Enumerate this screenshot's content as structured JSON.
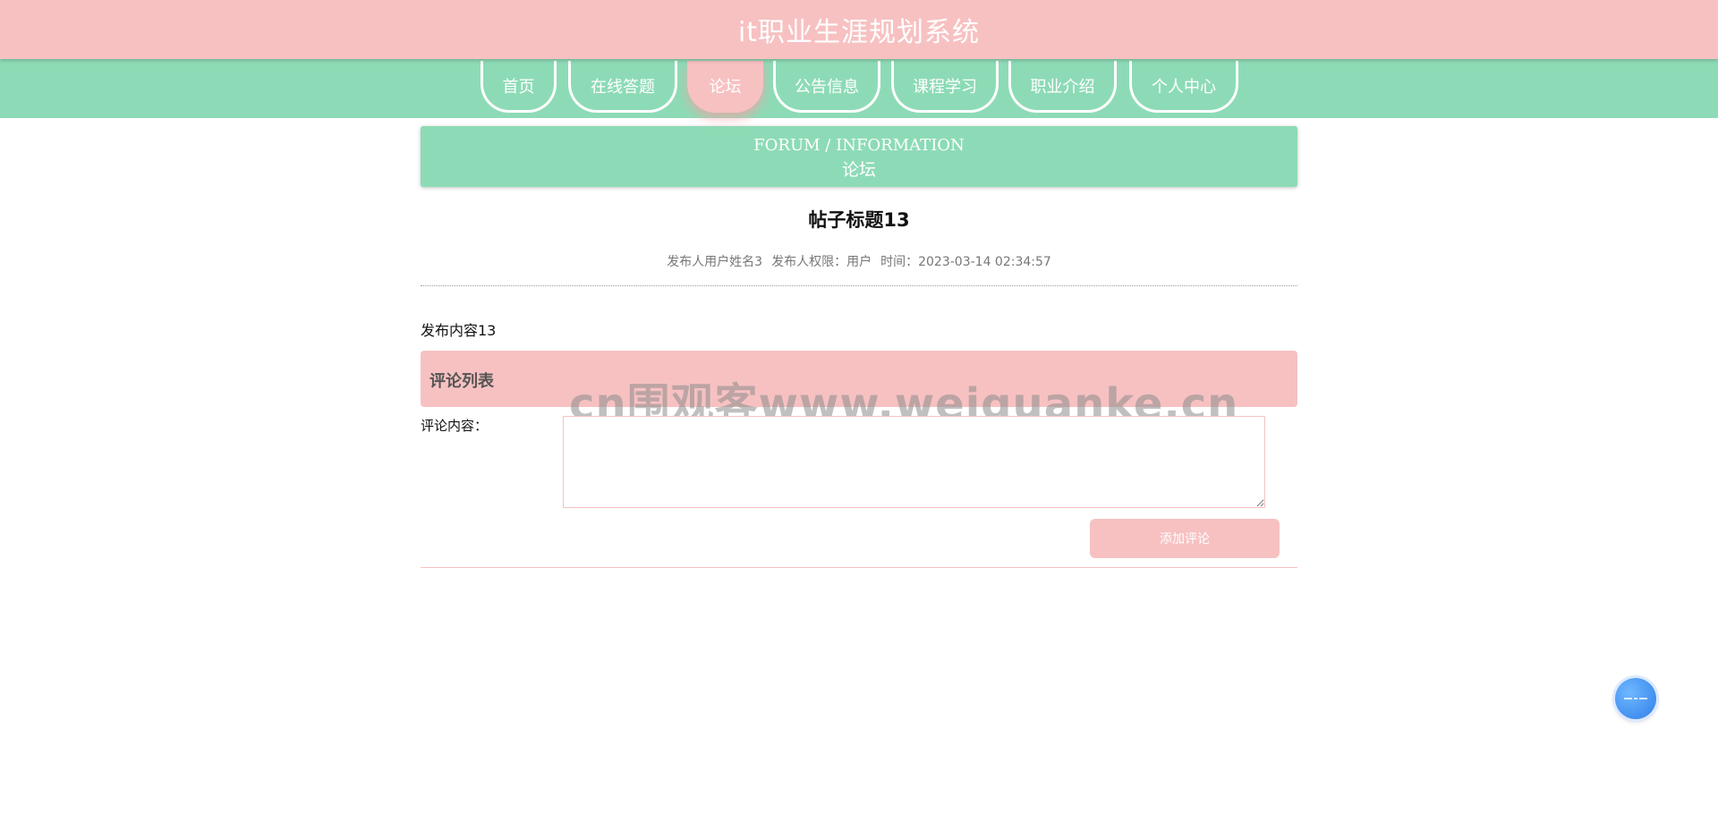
{
  "header": {
    "site_title": "it职业生涯规划系统"
  },
  "nav": {
    "items": [
      {
        "label": "首页"
      },
      {
        "label": "在线答题"
      },
      {
        "label": "论坛",
        "active": true
      },
      {
        "label": "公告信息"
      },
      {
        "label": "课程学习"
      },
      {
        "label": "职业介绍"
      },
      {
        "label": "个人中心"
      }
    ]
  },
  "section": {
    "title_en": "FORUM / INFORMATION",
    "title_cn": "论坛"
  },
  "post": {
    "title": "帖子标题13",
    "author": "发布人用户姓名3",
    "permission": "发布人权限：用户",
    "time": "时间：2023-03-14 02:34:57",
    "content": "发布内容13"
  },
  "comments": {
    "header": "评论列表",
    "input_label": "评论内容：",
    "input_value": "",
    "submit_label": "添加评论"
  },
  "watermark": "cn围观客www.weiguanke.cn",
  "colors": {
    "pink": "#f7c1c2",
    "green": "#8ddbb6",
    "float_blue": "#2f7fe8"
  },
  "float_button": {
    "icon": "chat-bubble-icon"
  }
}
